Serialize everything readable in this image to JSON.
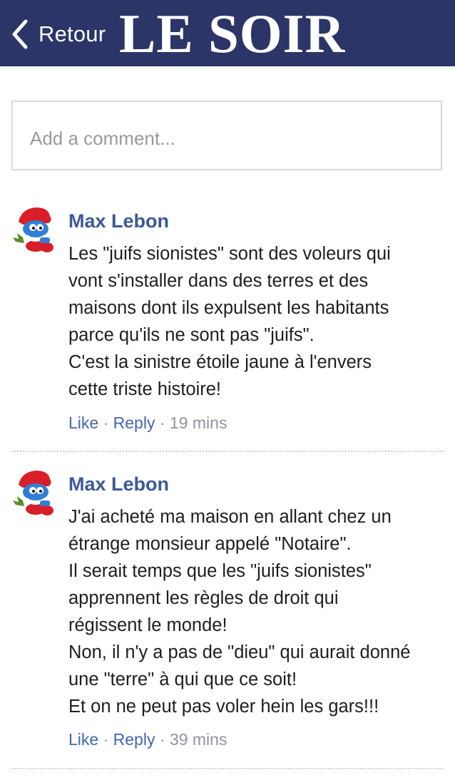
{
  "header": {
    "back_label": "Retour",
    "logo_text": "LE SOIR",
    "background_color": "#2b3567"
  },
  "comment_box": {
    "placeholder": "Add a comment..."
  },
  "comments": [
    {
      "author": "Max Lebon",
      "avatar_icon": "smurf-avatar-icon",
      "lines": [
        "Les \"juifs sionistes\" sont des voleurs qui",
        "vont s'installer dans des terres et des",
        "maisons dont ils expulsent les habitants",
        "parce qu'ils ne sont pas \"juifs\".",
        "C'est la sinistre étoile jaune à l'envers",
        "cette triste histoire!"
      ],
      "like_label": "Like",
      "reply_label": "Reply",
      "separator": "·",
      "time": "19 mins"
    },
    {
      "author": "Max Lebon",
      "avatar_icon": "smurf-avatar-icon",
      "lines": [
        "J'ai acheté ma maison en allant chez un",
        "étrange monsieur appelé \"Notaire\".",
        "Il serait temps que les \"juifs sionistes\"",
        "apprennent les règles de droit qui",
        "régissent le monde!",
        "Non, il n'y a pas de \"dieu\" qui aurait donné",
        "une \"terre\" à qui que ce soit!",
        "Et on ne peut pas voler hein les gars!!!"
      ],
      "like_label": "Like",
      "reply_label": "Reply",
      "separator": "·",
      "time": "39 mins"
    }
  ]
}
